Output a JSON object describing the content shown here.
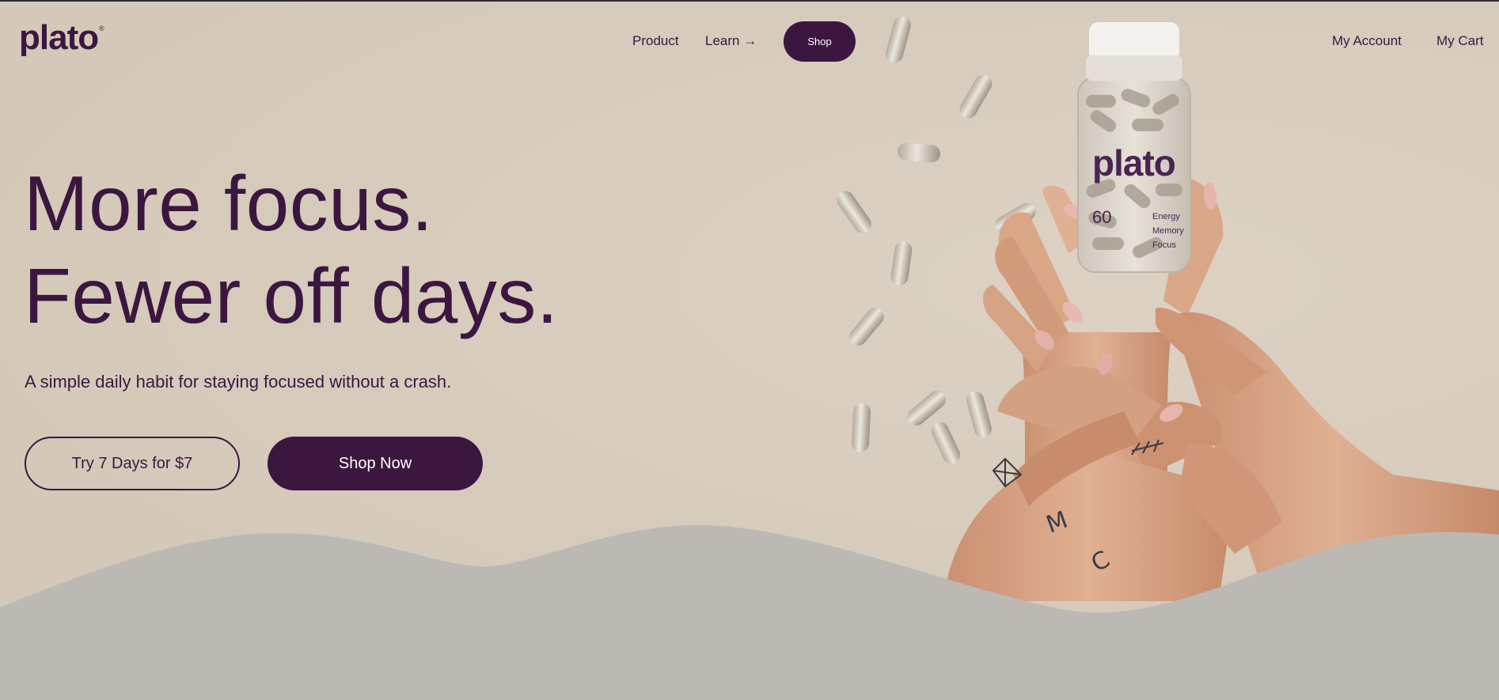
{
  "header": {
    "logo": "plato",
    "logo_mark": "®",
    "nav": {
      "product": "Product",
      "learn": "Learn →",
      "shop": "Shop",
      "account": "My Account",
      "cart": "My Cart"
    }
  },
  "hero": {
    "headline_line1": "More focus.",
    "headline_line2": "Fewer off days.",
    "subtitle": "A simple daily habit for staying focused without a crash.",
    "trial_button": "Try 7 Days for $7",
    "shop_button": "Shop Now"
  },
  "bottle": {
    "brand": "plato",
    "count": "60",
    "benefits": [
      "Energy",
      "Memory",
      "Focus"
    ]
  },
  "colors": {
    "brand": "#3b1740",
    "background": "#d6cabb",
    "wave": "#bcb9b4"
  }
}
